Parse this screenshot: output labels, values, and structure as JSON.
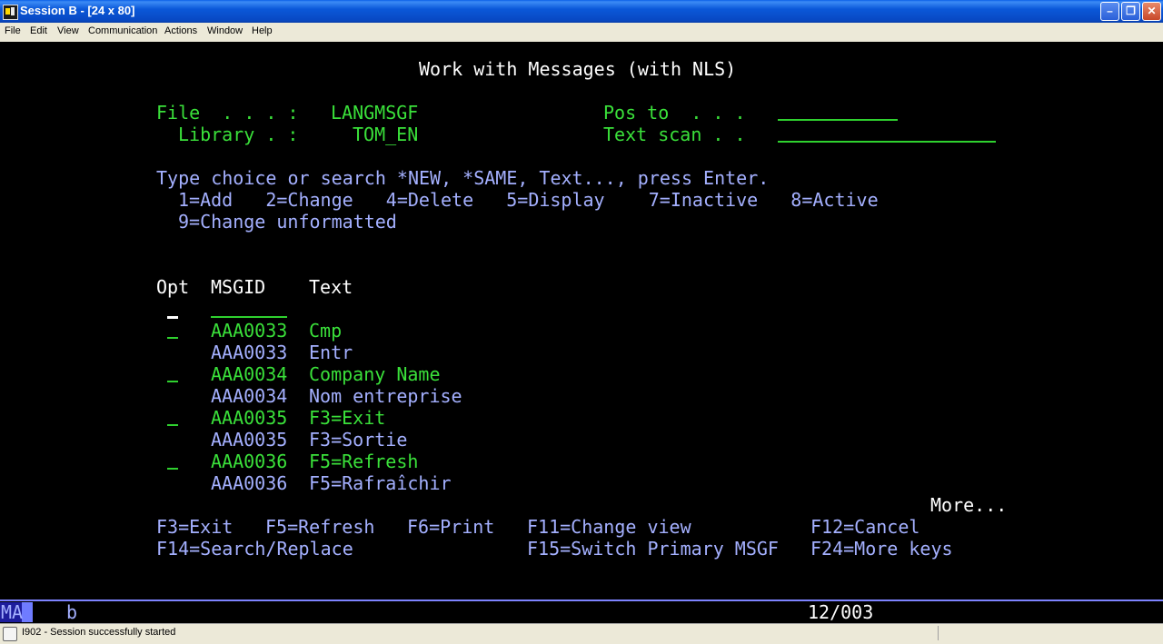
{
  "window": {
    "title": "Session B - [24 x 80]"
  },
  "menu": [
    "File",
    "Edit",
    "View",
    "Communication",
    "Actions",
    "Window",
    "Help"
  ],
  "screen": {
    "title": "Work with Messages (with NLS)",
    "file_label": "File  . . . :",
    "file_value": "LANGMSGF",
    "library_label": "Library . :",
    "library_value": "TOM_EN",
    "pos_to_label": "Pos to  . . .",
    "text_scan_label": "Text scan . .",
    "instructions": "Type choice or search *NEW, *SAME, Text..., press Enter.",
    "options_line1": "1=Add   2=Change   4=Delete   5=Display    7=Inactive   8=Active",
    "options_line2": "9=Change unformatted",
    "col_opt": "Opt",
    "col_msgid": "MSGID",
    "col_text": "Text",
    "rows": [
      {
        "msgid": "AAA0033",
        "text": "Cmp",
        "primary": true
      },
      {
        "msgid": "AAA0033",
        "text": "Entr",
        "primary": false
      },
      {
        "msgid": "AAA0034",
        "text": "Company Name",
        "primary": true
      },
      {
        "msgid": "AAA0034",
        "text": "Nom entreprise",
        "primary": false
      },
      {
        "msgid": "AAA0035",
        "text": "F3=Exit",
        "primary": true
      },
      {
        "msgid": "AAA0035",
        "text": "F3=Sortie",
        "primary": false
      },
      {
        "msgid": "AAA0036",
        "text": "F5=Refresh",
        "primary": true
      },
      {
        "msgid": "AAA0036",
        "text": "F5=Rafraîchir",
        "primary": false
      }
    ],
    "more": "More...",
    "fkeys": {
      "f3": "F3=Exit",
      "f5": "F5=Refresh",
      "f6": "F6=Print",
      "f11": "F11=Change view",
      "f12": "F12=Cancel",
      "f14": "F14=Search/Replace",
      "f15": "F15=Switch Primary MSGF",
      "f24": "F24=More keys"
    }
  },
  "oia": {
    "ma": "MA",
    "b": "b",
    "position": "12/003"
  },
  "status": {
    "message": "I902 - Session successfully started"
  },
  "colors": {
    "background": "#000000",
    "green": "#3ae03a",
    "blue": "#a4b0ff",
    "white": "#ffffff"
  }
}
